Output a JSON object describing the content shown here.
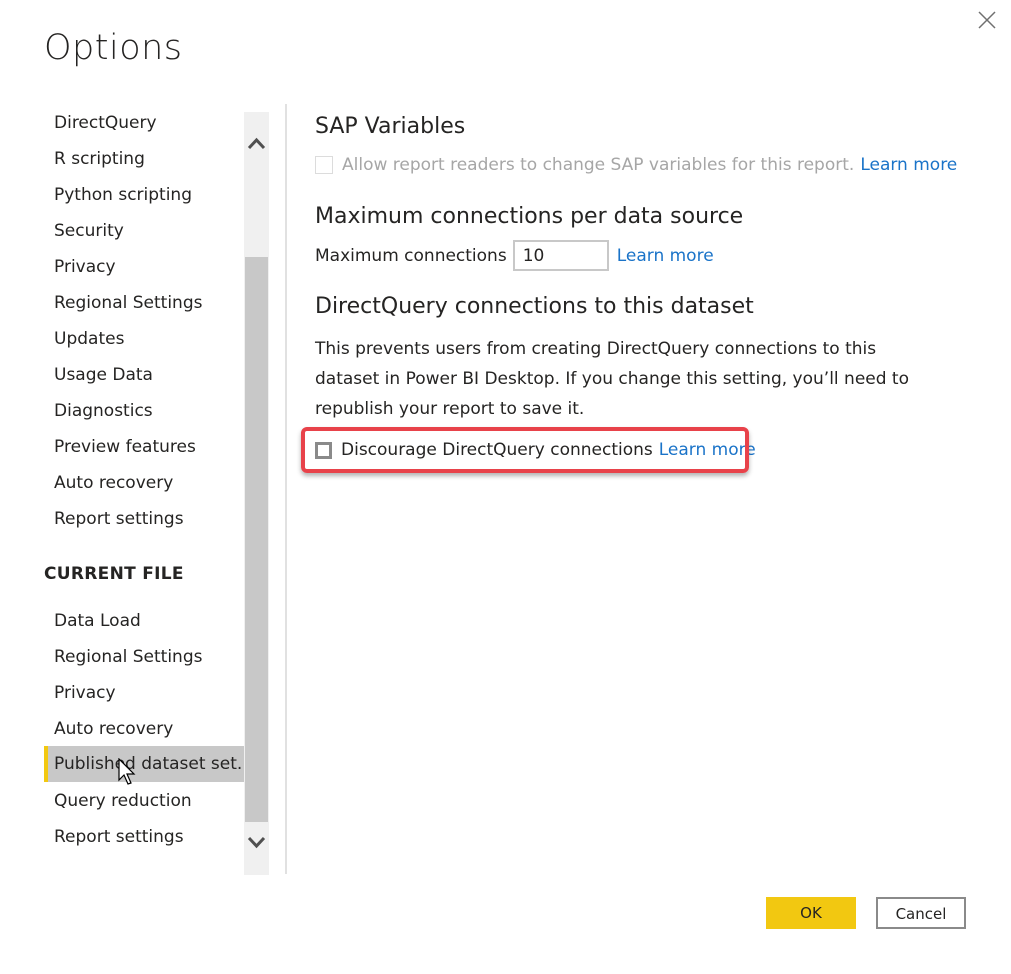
{
  "dialog": {
    "title": "Options",
    "close_icon": "close-icon"
  },
  "sidebar": {
    "global_items": [
      {
        "label": "DirectQuery"
      },
      {
        "label": "R scripting"
      },
      {
        "label": "Python scripting"
      },
      {
        "label": "Security"
      },
      {
        "label": "Privacy"
      },
      {
        "label": "Regional Settings"
      },
      {
        "label": "Updates"
      },
      {
        "label": "Usage Data"
      },
      {
        "label": "Diagnostics"
      },
      {
        "label": "Preview features"
      },
      {
        "label": "Auto recovery"
      },
      {
        "label": "Report settings"
      }
    ],
    "current_file_header": "CURRENT FILE",
    "current_file_items": [
      {
        "label": "Data Load"
      },
      {
        "label": "Regional Settings"
      },
      {
        "label": "Privacy"
      },
      {
        "label": "Auto recovery"
      },
      {
        "label": "Published dataset set...",
        "selected": true
      },
      {
        "label": "Query reduction"
      },
      {
        "label": "Report settings"
      }
    ],
    "selected_accent": "#f2c811"
  },
  "content": {
    "sap": {
      "heading": "SAP Variables",
      "checkbox_label": "Allow report readers to change SAP variables for this report.",
      "checkbox_checked": false,
      "checkbox_disabled": true,
      "learn_more": "Learn more"
    },
    "max_connections": {
      "heading": "Maximum connections per data source",
      "label": "Maximum connections",
      "value": "10",
      "learn_more": "Learn more"
    },
    "directquery": {
      "heading": "DirectQuery connections to this dataset",
      "description": "This prevents users from creating DirectQuery connections to this dataset in Power BI Desktop. If you change this setting, you’ll need to republish your report to save it.",
      "checkbox_label": "Discourage DirectQuery connections",
      "checkbox_checked": false,
      "learn_more": "Learn more",
      "highlight_color": "#e8424a"
    }
  },
  "footer": {
    "ok_label": "OK",
    "cancel_label": "Cancel",
    "ok_color": "#f2c811"
  }
}
